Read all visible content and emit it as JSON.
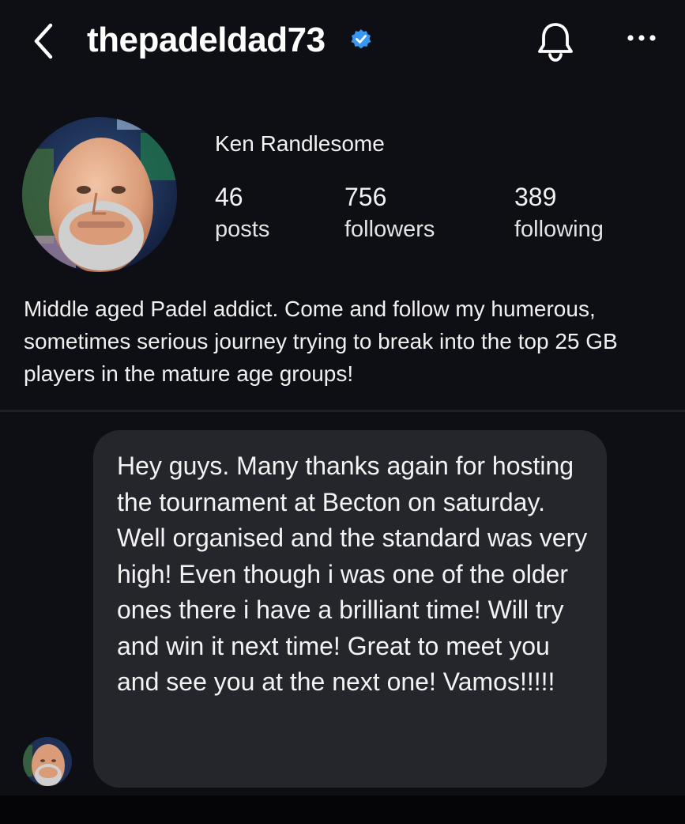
{
  "header": {
    "username": "thepadeldad73",
    "back_icon": "chevron-left-icon",
    "verified_icon": "verified-badge-icon",
    "notification_icon": "bell-icon",
    "more_icon": "more-horizontal-icon"
  },
  "profile": {
    "display_name": "Ken Randlesome",
    "stats": [
      {
        "value": "46",
        "label": "posts"
      },
      {
        "value": "756",
        "label": "followers"
      },
      {
        "value": "389",
        "label": "following"
      }
    ],
    "bio": "Middle aged Padel addict. Come and follow my humerous, sometimes serious journey trying to break into the top 25 GB players in the mature age groups!"
  },
  "message": {
    "text": "Hey guys. Many thanks again for hosting the tournament at Becton on saturday. Well organised and the standard was very high! Even though i was one of the older ones there i have a brilliant time! Will try and win it next time! Great to meet you and see you at the next one! Vamos!!!!!"
  },
  "colors": {
    "background": "#0e0f14",
    "bubble": "#25262c",
    "verified_blue": "#3897f0",
    "text": "#f5f5f5"
  }
}
